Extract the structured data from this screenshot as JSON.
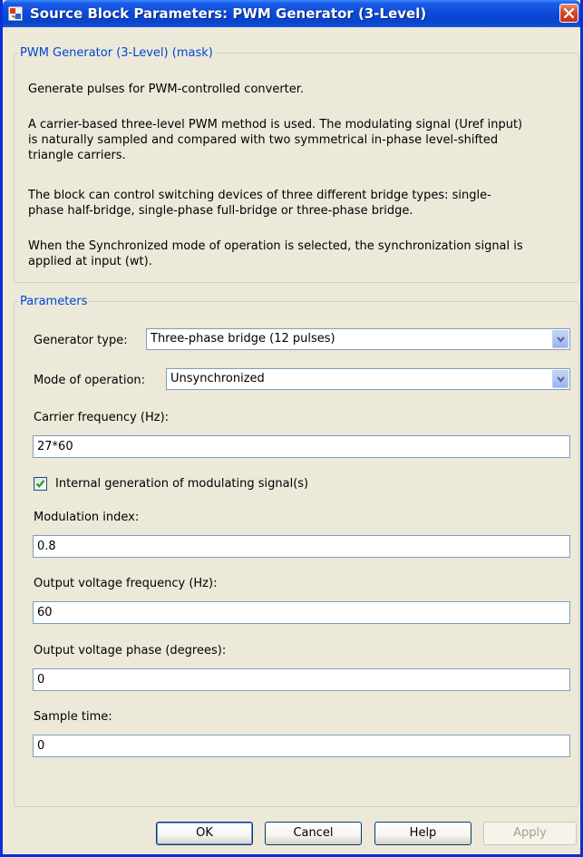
{
  "window": {
    "title": "Source Block Parameters: PWM Generator (3-Level)"
  },
  "mask": {
    "legend": "PWM Generator (3-Level) (mask)",
    "paragraphs": [
      [
        "Generate pulses for PWM-controlled converter."
      ],
      [
        "A carrier-based three-level PWM method is used. The modulating signal (Uref input)",
        "is naturally sampled and compared with two symmetrical in-phase level-shifted",
        "triangle carriers."
      ],
      [
        "The block can control switching devices of three different bridge types: single-",
        "phase half-bridge, single-phase full-bridge or three-phase bridge."
      ],
      [
        "When the Synchronized mode of operation is selected, the synchronization signal is",
        "applied at input (wt)."
      ]
    ]
  },
  "params": {
    "legend": "Parameters",
    "generator_type": {
      "label": "Generator type:",
      "value": "Three-phase bridge (12 pulses)"
    },
    "mode": {
      "label": "Mode of operation:",
      "value": "Unsynchronized"
    },
    "carrier_freq": {
      "label": "Carrier frequency (Hz):",
      "value": "27*60"
    },
    "internal_gen": {
      "label": "Internal generation of modulating signal(s)",
      "checked": true
    },
    "mod_index": {
      "label": "Modulation index:",
      "value": "0.8"
    },
    "out_freq": {
      "label": "Output voltage frequency (Hz):",
      "value": "60"
    },
    "out_phase": {
      "label": "Output voltage phase (degrees):",
      "value": "0"
    },
    "sample_time": {
      "label": "Sample time:",
      "value": "0"
    }
  },
  "buttons": {
    "ok": "OK",
    "cancel": "Cancel",
    "help": "Help",
    "apply": "Apply"
  },
  "colors": {
    "title_bar": "#0a49d6",
    "legend_text": "#0046d5",
    "close_button": "#d6472a",
    "dialog_bg": "#ece9d8"
  },
  "icons": {
    "title": "simulink-block-icon",
    "close": "close-icon",
    "dropdown": "chevron-down-icon",
    "check": "checkmark-icon"
  }
}
